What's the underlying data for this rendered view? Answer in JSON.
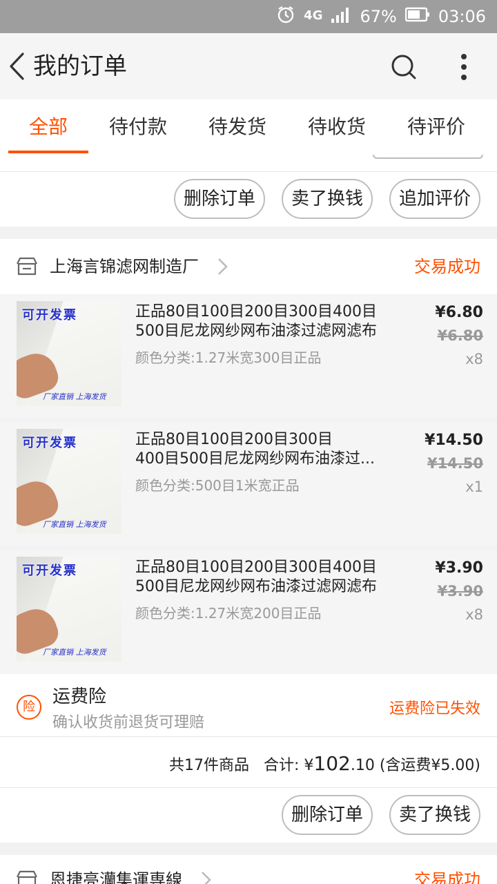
{
  "status_bar": {
    "network": "4G",
    "battery": "67%",
    "time": "03:06"
  },
  "header": {
    "title": "我的订单",
    "back_icon": "back-arrow-icon",
    "search_icon": "search-icon",
    "more_icon": "more-vertical-icon"
  },
  "tabs": [
    {
      "label": "全部",
      "active": true
    },
    {
      "label": "待付款",
      "active": false
    },
    {
      "label": "待发货",
      "active": false
    },
    {
      "label": "待收货",
      "active": false
    },
    {
      "label": "待评价",
      "active": false
    }
  ],
  "prev_order": {
    "buttons": {
      "delete": "删除订单",
      "sell": "卖了换钱",
      "review": "追加评价"
    }
  },
  "order": {
    "shop_name": "上海言锦滤网制造厂",
    "status": "交易成功",
    "items": [
      {
        "badge": "可开发票",
        "footer": "厂家直销 上海发货",
        "title": "正品80目100目200目300目400目\n500目尼龙网纱网布油漆过滤网滤布",
        "spec": "颜色分类:1.27米宽300目正品",
        "price": "¥6.80",
        "original_price": "¥6.80",
        "quantity": "x8"
      },
      {
        "badge": "可开发票",
        "footer": "厂家直销 上海发货",
        "title": "正品80目100目200目300目\n400目500目尼龙网纱网布油漆过...",
        "spec": "颜色分类:500目1米宽正品",
        "price": "¥14.50",
        "original_price": "¥14.50",
        "quantity": "x1"
      },
      {
        "badge": "可开发票",
        "footer": "厂家直销 上海发货",
        "title": "正品80目100目200目300目400目\n500目尼龙网纱网布油漆过滤网滤布",
        "spec": "颜色分类:1.27米宽200目正品",
        "price": "¥3.90",
        "original_price": "¥3.90",
        "quantity": "x8"
      }
    ],
    "insurance": {
      "icon_text": "险",
      "title": "运费险",
      "subtitle": "确认收货前退货可理赔",
      "status": "运费险已失效"
    },
    "summary": {
      "count": "共17件商品",
      "total_label": "合计:",
      "currency": "¥",
      "total_int": "102",
      "total_dec": ".10",
      "shipping": "(含运费¥5.00)"
    },
    "buttons": {
      "delete": "删除订单",
      "sell": "卖了换钱"
    }
  },
  "next_order": {
    "shop_name": "恩捷亮灡集運専線",
    "status": "交易成功"
  },
  "colors": {
    "accent": "#ff5000",
    "status_bar": "#9e9e9e"
  }
}
